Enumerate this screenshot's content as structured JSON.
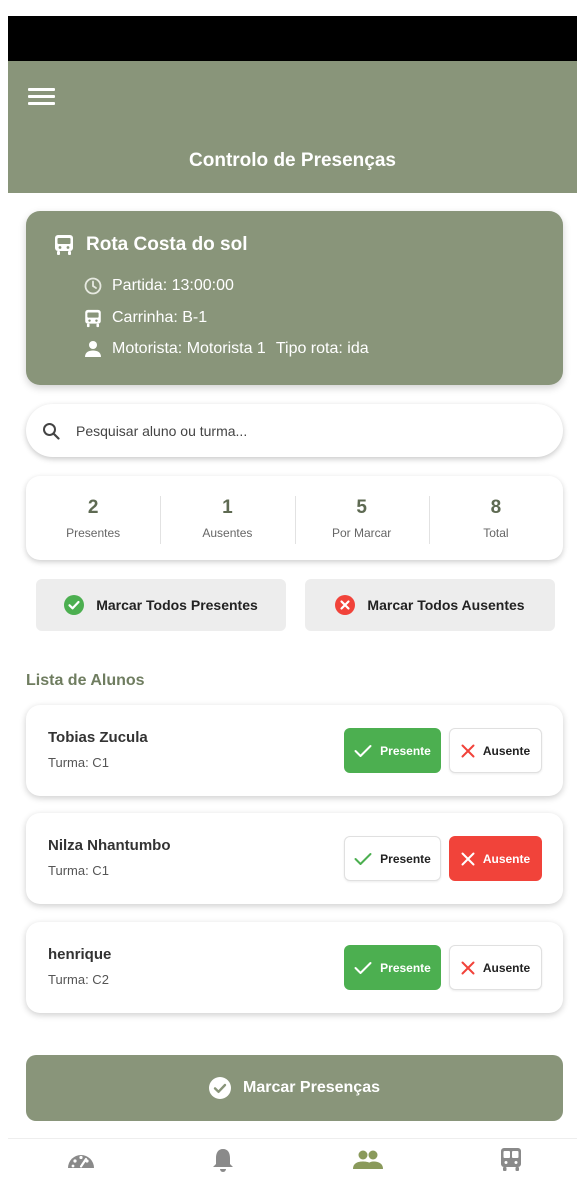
{
  "header": {
    "title": "Controlo de Presenças",
    "menu_icon": "hamburger-menu-icon"
  },
  "route": {
    "name": "Rota Costa do sol",
    "departure": "Partida: 13:00:00",
    "vehicle": "Carrinha: B-1",
    "driver": "Motorista: Motorista 1",
    "route_type": "Tipo rota: ida"
  },
  "search": {
    "placeholder": "Pesquisar aluno ou turma...",
    "value": ""
  },
  "stats": [
    {
      "value": "2",
      "label": "Presentes"
    },
    {
      "value": "1",
      "label": "Ausentes"
    },
    {
      "value": "5",
      "label": "Por Marcar"
    },
    {
      "value": "8",
      "label": "Total"
    }
  ],
  "bulk_actions": {
    "mark_all_present": "Marcar Todos Presentes",
    "mark_all_absent": "Marcar Todos Ausentes"
  },
  "list": {
    "title": "Lista de Alunos",
    "present_label": "Presente",
    "absent_label": "Ausente",
    "students": [
      {
        "name": "Tobias Zucula",
        "class": "Turma: C1",
        "status": "present"
      },
      {
        "name": "Nilza Nhantumbo",
        "class": "Turma: C1",
        "status": "absent"
      },
      {
        "name": "henrique",
        "class": "Turma: C2",
        "status": "present"
      }
    ]
  },
  "submit": {
    "label": "Marcar Presenças"
  },
  "colors": {
    "primary": "#89957a",
    "present_green": "#4caf50",
    "absent_red": "#f1433a",
    "stat_number": "#5e6a52"
  },
  "bottom_nav": [
    "dashboard-icon",
    "notifications-icon",
    "students-icon",
    "bus-icon"
  ]
}
